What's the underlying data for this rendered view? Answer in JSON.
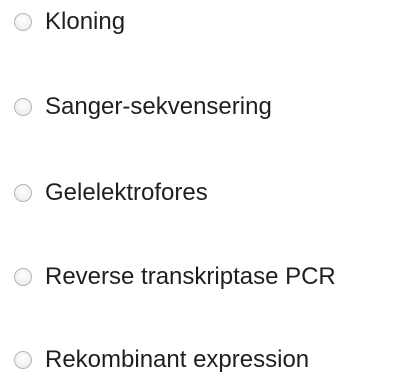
{
  "question": {
    "options": [
      {
        "label": "Kloning",
        "selected": false
      },
      {
        "label": "Sanger-sekvensering",
        "selected": false
      },
      {
        "label": "Gelelektrofores",
        "selected": false
      },
      {
        "label": "Reverse transkriptase PCR",
        "selected": false
      },
      {
        "label": "Rekombinant expression",
        "selected": false
      }
    ]
  },
  "colors": {
    "text": "#1f1f1f",
    "radio_border": "#b6b6b6",
    "background": "#ffffff"
  }
}
